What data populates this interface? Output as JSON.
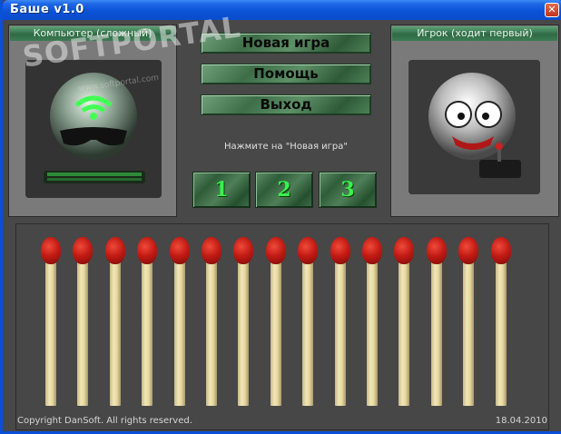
{
  "window": {
    "title": "Баше  v1.0",
    "close_glyph": "✕"
  },
  "left_panel": {
    "header": "Компьютер (сложный)",
    "avatar_icon": "alien-computer-player-icon"
  },
  "right_panel": {
    "header": "Игрок (ходит первый)",
    "avatar_icon": "joystick-player-icon"
  },
  "menu": {
    "new_game": "Новая игра",
    "help": "Помощь",
    "exit": "Выход"
  },
  "hint": "Нажмите на \"Новая игра\"",
  "take_buttons": [
    "1",
    "2",
    "3"
  ],
  "matches": {
    "count": 15
  },
  "footer": {
    "copyright": "Copyright DanSoft. All rights reserved.",
    "date": "18.04.2010"
  },
  "watermark": {
    "text": "SOFTPORTAL",
    "url": "www.softportal.com"
  },
  "colors": {
    "title_bar": "#0a52d6",
    "button_green": "#3d6e48",
    "number_green": "#39f24b",
    "match_head": "#c31b14"
  }
}
